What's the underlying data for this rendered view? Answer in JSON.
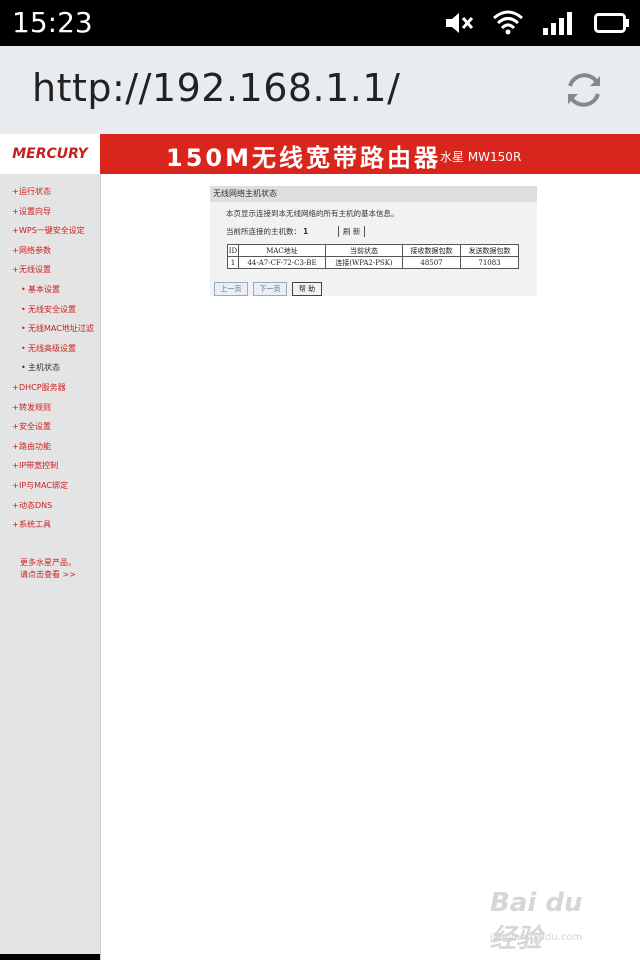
{
  "status_bar": {
    "time": "15:23",
    "icons": [
      "mute-icon",
      "wifi-icon",
      "signal-icon",
      "battery-icon"
    ]
  },
  "browser": {
    "url": "http://192.168.1.1/",
    "reload_icon": "reload-icon"
  },
  "header": {
    "logo": "MERCURY",
    "title": "150M无线宽带路由器",
    "model": "水星 MW150R",
    "colors": {
      "header_bg": "#d9251c",
      "logo": "#c81e1e"
    }
  },
  "sidebar": {
    "items": [
      {
        "label": "运行状态",
        "sub": false,
        "current": false
      },
      {
        "label": "设置向导",
        "sub": false,
        "current": false
      },
      {
        "label": "WPS一键安全设定",
        "sub": false,
        "current": false
      },
      {
        "label": "网络参数",
        "sub": false,
        "current": false
      },
      {
        "label": "无线设置",
        "sub": false,
        "current": false
      },
      {
        "label": "基本设置",
        "sub": true,
        "current": false
      },
      {
        "label": "无线安全设置",
        "sub": true,
        "current": false
      },
      {
        "label": "无线MAC地址过滤",
        "sub": true,
        "current": false
      },
      {
        "label": "无线高级设置",
        "sub": true,
        "current": false
      },
      {
        "label": "主机状态",
        "sub": true,
        "current": true
      },
      {
        "label": "DHCP服务器",
        "sub": false,
        "current": false
      },
      {
        "label": "转发规则",
        "sub": false,
        "current": false
      },
      {
        "label": "安全设置",
        "sub": false,
        "current": false
      },
      {
        "label": "路由功能",
        "sub": false,
        "current": false
      },
      {
        "label": "IP带宽控制",
        "sub": false,
        "current": false
      },
      {
        "label": "IP与MAC绑定",
        "sub": false,
        "current": false
      },
      {
        "label": "动态DNS",
        "sub": false,
        "current": false
      },
      {
        "label": "系统工具",
        "sub": false,
        "current": false
      }
    ],
    "promo_line1": "更多水星产品，",
    "promo_line2": "请点击查看 >>"
  },
  "panel": {
    "title": "无线网络主机状态",
    "description": "本页显示连接到本无线网络的所有主机的基本信息。",
    "count_label": "当前所连接的主机数：",
    "count_value": "1",
    "refresh_label": "刷 新",
    "table": {
      "headers": [
        "ID",
        "MAC地址",
        "当前状态",
        "接收数据包数",
        "发送数据包数"
      ],
      "rows": [
        [
          "1",
          "44-A7-CF-72-C3-BE",
          "连接(WPA2-PSK)",
          "48507",
          "71083"
        ]
      ]
    },
    "buttons": {
      "prev": "上一页",
      "next": "下一页",
      "help": "帮 助"
    }
  },
  "watermark": {
    "brand": "Bai du 经验",
    "url": "jingyan.baidu.com"
  }
}
